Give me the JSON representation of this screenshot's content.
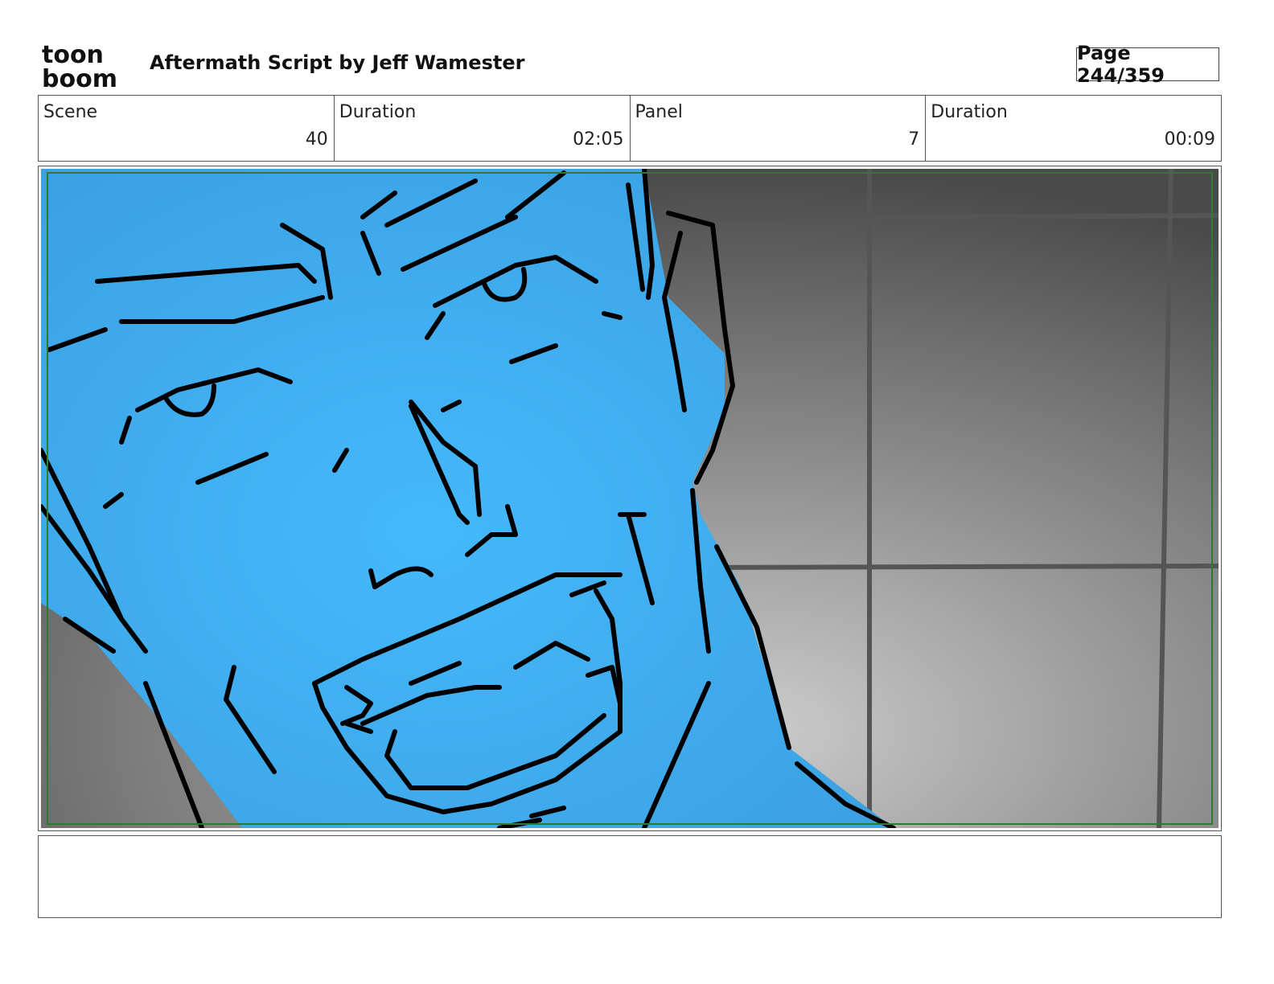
{
  "header": {
    "logo_top": "toon",
    "logo_bottom": "boom",
    "title": "Aftermath  Script by Jeff Wamester",
    "page_label": "Page 244/359"
  },
  "info": [
    {
      "label": "Scene",
      "value": "40"
    },
    {
      "label": "Duration",
      "value": "02:05"
    },
    {
      "label": "Panel",
      "value": "7"
    },
    {
      "label": "Duration",
      "value": "00:09"
    }
  ],
  "panel": {
    "description": "",
    "colors": {
      "skin": "#45b9fb",
      "wall_light": "#cccccc",
      "wall_dark": "#4a4a4a",
      "safe_frame": "#2f7a2f",
      "line": "#000000"
    }
  },
  "notes": {
    "text": ""
  }
}
